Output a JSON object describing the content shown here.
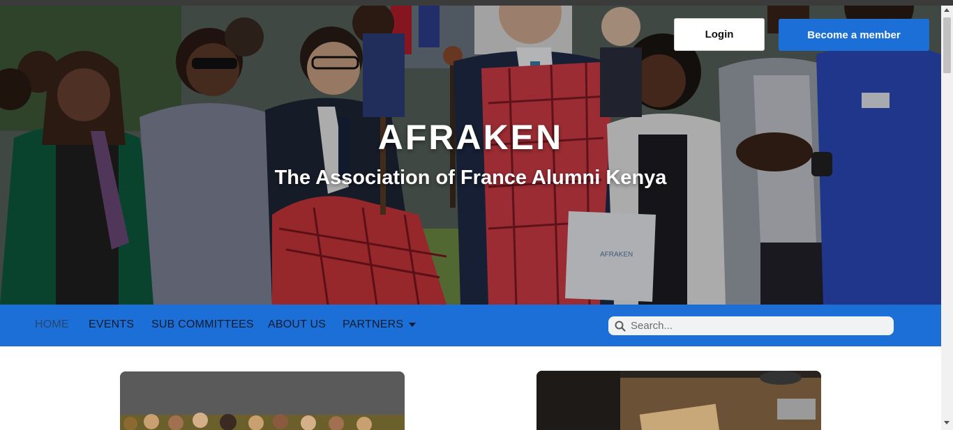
{
  "site": {
    "title": "AFRAKEN",
    "subtitle": "The Association of France Alumni Kenya"
  },
  "header": {
    "login_label": "Login",
    "member_label": "Become a member"
  },
  "nav": {
    "items": [
      {
        "label": "HOME",
        "active": true
      },
      {
        "label": "EVENTS"
      },
      {
        "label": "SUB COMMITTEES"
      },
      {
        "label": "ABOUT US"
      },
      {
        "label": "PARTNERS",
        "dropdown": true
      }
    ]
  },
  "search": {
    "placeholder": "Search...",
    "value": ""
  },
  "hero_bag_text": "AFRAKEN",
  "colors": {
    "brand_blue": "#1b6fd6",
    "nav_text": "#0e1b2e"
  },
  "icons": {
    "search": "search-icon",
    "dropdown": "caret-down-icon"
  }
}
